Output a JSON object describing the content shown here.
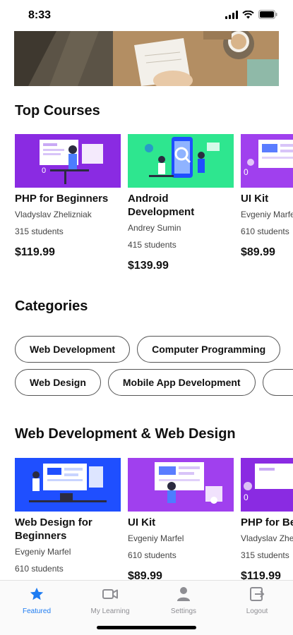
{
  "status_bar": {
    "time": "8:33"
  },
  "top_courses": {
    "title": "Top Courses",
    "courses": [
      {
        "title": "PHP for Beginners",
        "author": "Vladyslav Zhelizniak",
        "students": "315 students",
        "price": "$119.99"
      },
      {
        "title": "Android Development",
        "author": "Andrey Sumin",
        "students": "415 students",
        "price": "$139.99"
      },
      {
        "title": "UI Kit",
        "author": "Evgeniy Marfel",
        "students": "610 students",
        "price": "$89.99"
      }
    ]
  },
  "categories": {
    "title": "Categories",
    "row1": [
      "Web Development",
      "Computer Programming"
    ],
    "row2": [
      "Web Design",
      "Mobile App Development",
      ""
    ]
  },
  "web_section": {
    "title": "Web Development & Web Design",
    "courses": [
      {
        "title": "Web Design for Beginners",
        "author": "Evgeniy Marfel",
        "students": "610 students",
        "price": ""
      },
      {
        "title": "UI Kit",
        "author": "Evgeniy Marfel",
        "students": "610 students",
        "price": "$89.99"
      },
      {
        "title": "PHP for Beginners",
        "author": "Vladyslav Zhelizniak",
        "students": "315 students",
        "price": "$119.99"
      }
    ]
  },
  "tab_bar": {
    "featured": "Featured",
    "my_learning": "My Learning",
    "settings": "Settings",
    "logout": "Logout"
  },
  "colors": {
    "accent": "#1e7cf2",
    "purple": "#8a2be2",
    "green": "#2ee68f",
    "blue": "#1f4fff"
  }
}
